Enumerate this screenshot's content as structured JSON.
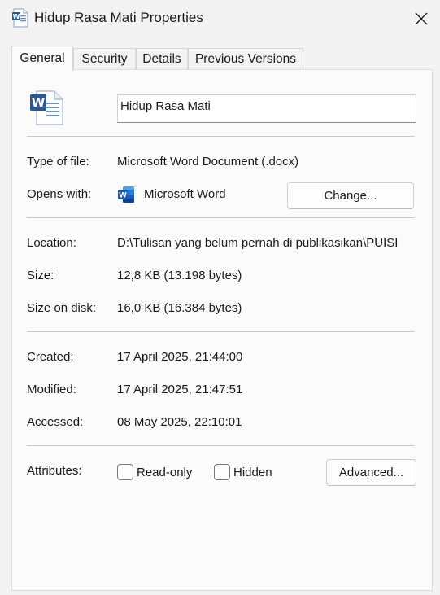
{
  "window": {
    "title": "Hidup Rasa Mati Properties",
    "icon": "word-document-icon"
  },
  "tabs": [
    {
      "label": "General",
      "active": true
    },
    {
      "label": "Security",
      "active": false
    },
    {
      "label": "Details",
      "active": false
    },
    {
      "label": "Previous Versions",
      "active": false
    }
  ],
  "general": {
    "file_name": "Hidup Rasa Mati",
    "type_label": "Type of file:",
    "type_value": "Microsoft Word Document (.docx)",
    "opens_label": "Opens with:",
    "opens_value": "Microsoft Word",
    "change_label": "Change...",
    "location_label": "Location:",
    "location_value": "D:\\Tulisan yang belum pernah di publikasikan\\PUISI",
    "size_label": "Size:",
    "size_value": "12,8 KB (13.198 bytes)",
    "disk_label": "Size on disk:",
    "disk_value": "16,0 KB (16.384 bytes)",
    "created_label": "Created:",
    "created_value": "17 April 2025, 21:44:00",
    "modified_label": "Modified:",
    "modified_value": "17 April 2025, 21:47:51",
    "accessed_label": "Accessed:",
    "accessed_value": "08 May 2025, 22:10:01",
    "attributes_label": "Attributes:",
    "readonly_label": "Read-only",
    "readonly_checked": false,
    "hidden_label": "Hidden",
    "hidden_checked": false,
    "advanced_label": "Advanced..."
  },
  "colors": {
    "word_blue": "#2b579a",
    "word_light": "#41a5ee"
  }
}
